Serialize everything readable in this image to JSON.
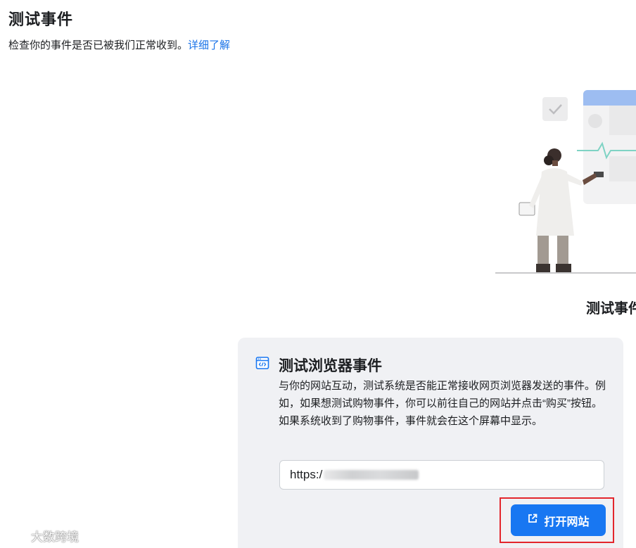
{
  "header": {
    "title": "测试事件",
    "subtitle": "检查你的事件是否已被我们正常收到。",
    "learn_more": "详细了解"
  },
  "illustration": {
    "heading": "测试事件"
  },
  "card": {
    "icon": "browser-code-icon",
    "title": "测试浏览器事件",
    "description": "与你的网站互动，测试系统是否能正常接收网页浏览器发送的事件。例如，如果想测试购物事件，你可以前往自己的网站并点击“购买”按钮。如果系统收到了购物事件，事件就会在这个屏幕中显示。",
    "url_value": "https:/",
    "open_button_label": "打开网站",
    "open_button_icon": "external-link-icon"
  },
  "watermark": {
    "text": "大数跨境"
  },
  "colors": {
    "accent": "#1877f2",
    "link": "#1a73e8",
    "card_bg": "#f0f1f4",
    "highlight": "#e3262c"
  }
}
